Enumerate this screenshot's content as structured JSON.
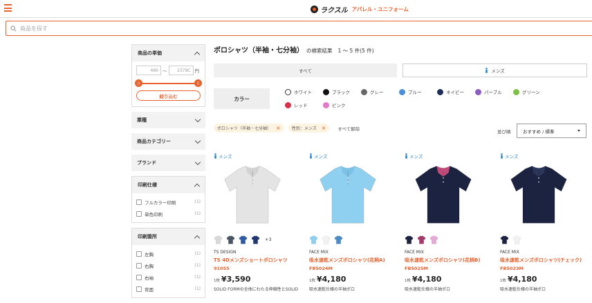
{
  "header": {
    "menu_icon": "hamburger-icon",
    "logo_text": "ラクスル",
    "logo_sub": "アパレル・ユニフォーム"
  },
  "search": {
    "placeholder": "商品を探す",
    "icon": "search-icon"
  },
  "sidebar": {
    "price": {
      "title": "商品の単価",
      "min": "490",
      "max": "2379C",
      "sep": "〜",
      "unit": "円",
      "knob": "||",
      "button": "絞り込む"
    },
    "industry": {
      "title": "業種"
    },
    "category": {
      "title": "商品カテゴリー"
    },
    "brand": {
      "title": "ブランド"
    },
    "print_spec": {
      "title": "印刷仕様",
      "items": [
        {
          "label": "フルカラー印刷",
          "count": "(1)"
        },
        {
          "label": "単色印刷",
          "count": "(1)"
        }
      ]
    },
    "print_place": {
      "title": "印刷箇所",
      "items": [
        {
          "label": "左胸",
          "count": "(1)"
        },
        {
          "label": "右胸",
          "count": "(1)"
        },
        {
          "label": "右袖",
          "count": "(1)"
        },
        {
          "label": "背面",
          "count": "(1)"
        }
      ]
    }
  },
  "main": {
    "title": "ポロシャツ（半袖・七分袖）",
    "title_suffix": "の検索結果",
    "count": "1 〜 5 件(5 件)",
    "tabs": [
      {
        "label": "すべて"
      },
      {
        "label": "メンズ"
      }
    ],
    "color_label": "カラー",
    "colors": [
      {
        "label": "ホワイト",
        "hex": "#ffffff"
      },
      {
        "label": "ブラック",
        "hex": "#111111"
      },
      {
        "label": "グレー",
        "hex": "#666666"
      },
      {
        "label": "ブルー",
        "hex": "#4a90d9"
      },
      {
        "label": "ネイビー",
        "hex": "#1f2d5c"
      },
      {
        "label": "パープル",
        "hex": "#8a5cc0"
      },
      {
        "label": "グリーン",
        "hex": "#7cc142"
      },
      {
        "label": "レッド",
        "hex": "#d9304a"
      },
      {
        "label": "ピンク",
        "hex": "#e07ac9"
      }
    ],
    "chips": [
      {
        "label": "ポロシャツ（半袖・七分袖）"
      },
      {
        "label": "性別：メンズ"
      }
    ],
    "clear_all": "すべて解除",
    "sort_label": "並び順",
    "sort_value": "おすすめ / 標準",
    "products": [
      {
        "gender": "メンズ",
        "shirt_color": "#e4e4e4",
        "collar_color": "#d2d2d2",
        "swatches": [
          "#d9d9d9",
          "#4a5563",
          "#2e5aa3",
          "#20376f"
        ],
        "more": "+3",
        "brand": "TS DESIGN",
        "name": "TS 4Dメンズショートポロシャツ",
        "code": "91055",
        "unit": "1枚",
        "price": "¥3,590",
        "desc": "SOLID FORMの全体にわたる伸縮性とSOLID"
      },
      {
        "gender": "メンズ",
        "shirt_color": "#8fd0f0",
        "collar_color": "#7cc2e6",
        "swatches": [
          "#8fd0f0",
          "#f2f2f2",
          "#4b8cc8"
        ],
        "more": "",
        "brand": "FACE MIX",
        "name": "吸水速乾メンズポロシャツ(花柄A)",
        "code": "FB5024M",
        "unit": "1枚",
        "price": "¥4,180",
        "desc": "吸水速乾仕様の半袖ポロ"
      },
      {
        "gender": "メンズ",
        "shirt_color": "#1b2340",
        "collar_color": "#c24a7a",
        "swatches": [
          "#1b2340",
          "#a33a6a",
          "#e4a9d6"
        ],
        "more": "",
        "brand": "FACE MIX",
        "name": "吸水速乾メンズポロシャツ(花柄B)",
        "code": "FB5025M",
        "unit": "1枚",
        "price": "¥4,180",
        "desc": "吸水速乾仕様の半袖ポロ"
      },
      {
        "gender": "メンズ",
        "shirt_color": "#1b2340",
        "collar_color": "#2c365a",
        "swatches": [
          "#1b2340",
          "#f2f2f2"
        ],
        "more": "",
        "brand": "FACE MIX",
        "name": "吸水速乾メンズポロシャツ(チェック)",
        "code": "FB5023M",
        "unit": "1枚",
        "price": "¥4,180",
        "desc": "吸水速乾仕様の半袖ポロ"
      }
    ]
  }
}
